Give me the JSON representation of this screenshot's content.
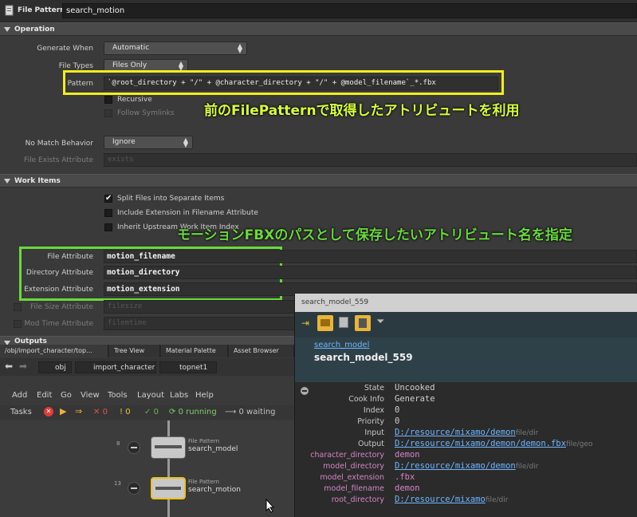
{
  "titlebar": {
    "type_label": "File Pattern",
    "node_name": "search_motion"
  },
  "operation": {
    "section_label": "Operation",
    "generate_when": {
      "label": "Generate When",
      "value": "Automatic"
    },
    "file_types": {
      "label": "File Types",
      "value": "Files Only"
    },
    "pattern": {
      "label": "Pattern",
      "value": "`@root_directory + \"/\" + @character_directory + \"/\" + @model_filename`_*.fbx"
    },
    "recursive": {
      "label": "Recursive"
    },
    "follow_symlinks": {
      "label": "Follow Symlinks"
    },
    "no_match": {
      "label": "No Match Behavior",
      "value": "Ignore"
    },
    "file_exists": {
      "label": "File Exists Attribute",
      "value": "exists"
    }
  },
  "work_items": {
    "section_label": "Work Items",
    "split_files": {
      "label": "Split Files into Separate Items",
      "checked": true
    },
    "include_ext": {
      "label": "Include Extension in Filename Attribute"
    },
    "inherit_upstream": {
      "label": "Inherit Upstream Work Item Index"
    },
    "file_attr": {
      "label": "File Attribute",
      "value": "motion_filename"
    },
    "dir_attr": {
      "label": "Directory Attribute",
      "value": "motion_directory"
    },
    "ext_attr": {
      "label": "Extension Attribute",
      "value": "motion_extension"
    },
    "file_size": {
      "label": "File Size Attribute",
      "value": "filesize"
    },
    "mod_time": {
      "label": "Mod Time Attribute",
      "value": "filemtime"
    }
  },
  "outputs": {
    "section_label": "Outputs"
  },
  "annotations": {
    "pattern_note": "前のFilePatternで取得したアトリビュートを利用",
    "attr_note": "モーションFBXのパスとして保存したいアトリビュート名を指定"
  },
  "network": {
    "tabs": [
      "/obj/import_character/top...",
      "Tree View",
      "Material Palette",
      "Asset Browser"
    ],
    "path": [
      "obj",
      "import_character",
      "topnet1"
    ],
    "menu": [
      "Add",
      "Edit",
      "Go",
      "View",
      "Tools",
      "Layout",
      "Labs",
      "Help"
    ],
    "tasks_label": "Tasks",
    "counts": {
      "failed": "0",
      "warnings": "0",
      "cooked": "0",
      "running": "0 running",
      "waiting": "0 waiting"
    },
    "nodes": [
      {
        "index": "8",
        "type": "File Pattern",
        "name": "search_model"
      },
      {
        "index": "13",
        "type": "File Pattern",
        "name": "search_motion"
      }
    ]
  },
  "info_panel": {
    "title": "search_model_559",
    "node_link": "search_model",
    "item_name": "search_model_559",
    "rows": [
      {
        "key": "State",
        "value": "Uncooked"
      },
      {
        "key": "Cook Info",
        "value": "Generate"
      },
      {
        "key": "Index",
        "value": "0"
      },
      {
        "key": "Priority",
        "value": "0"
      }
    ],
    "input": {
      "key": "Input",
      "value": "D:/resource/mixamo/demon",
      "tag": "file/dir"
    },
    "output": {
      "key": "Output",
      "value": "D:/resource/mixamo/demon/demon.fbx",
      "tag": "file/geo"
    },
    "attrs": [
      {
        "key": "character_directory",
        "value": "demon"
      },
      {
        "key": "model_directory",
        "value": "D:/resource/mixamo/demon",
        "tag": "file/dir"
      },
      {
        "key": "model_extension",
        "value": ".fbx"
      },
      {
        "key": "model_filename",
        "value": "demon"
      },
      {
        "key": "root_directory",
        "value": "D:/resource/mixamo",
        "tag": "file/dir"
      }
    ]
  },
  "colors": {
    "highlight_yellow": "#f2ee1e",
    "highlight_green": "#6ad93a",
    "note_text": "#d7ff3a",
    "link": "#6fb6ff",
    "attr_key": "#d583c4"
  }
}
